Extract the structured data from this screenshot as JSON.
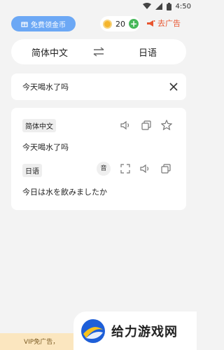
{
  "status_bar": {
    "time": "4:50"
  },
  "header": {
    "promo_label": "免费领金币",
    "coin_count": "20",
    "ads_label": "去广告"
  },
  "lang_bar": {
    "source": "简体中文",
    "target": "日语"
  },
  "input": {
    "text": "今天喝水了吗"
  },
  "result": {
    "source_tag": "简体中文",
    "source_text": "今天喝水了吗",
    "target_tag": "日语",
    "pronounce_label": "音",
    "target_text": "今日は水を飲みましたか"
  },
  "footer": {
    "vip_label": "VIP免广告，",
    "watermark_text": "给力游戏网"
  },
  "colors": {
    "promo": "#6ca8f5",
    "accent_red": "#e8552f",
    "plus_green": "#47b85a",
    "vip_bg": "#fbe6bf"
  }
}
